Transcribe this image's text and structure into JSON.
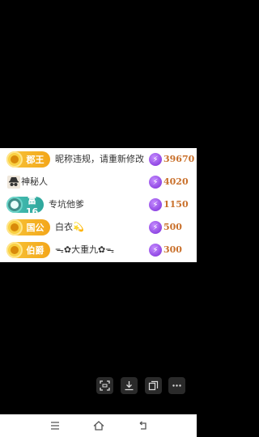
{
  "ranking": {
    "rows": [
      {
        "badge": "郡王",
        "name": "昵称违规，请重新修改",
        "score": "39670",
        "icon": "purple-gift-icon"
      },
      {
        "badge": "",
        "name": "神秘人",
        "score": "4020",
        "icon": "purple-gift-icon"
      },
      {
        "badge": "富16",
        "name": "专坑他爹",
        "score": "1150",
        "icon": "purple-gift-icon"
      },
      {
        "badge": "国公",
        "name": "白衣💫",
        "score": "500",
        "icon": "purple-gift-icon"
      },
      {
        "badge": "伯爵",
        "name": "ᯓ✿大重九✿ᯓ",
        "score": "300",
        "icon": "purple-gift-icon"
      }
    ]
  },
  "toolbar": {
    "icons": [
      "scan-icon",
      "download-icon",
      "copy-icon",
      "more-icon"
    ]
  },
  "navbar": {
    "icons": [
      "menu-icon",
      "home-icon",
      "back-icon"
    ]
  }
}
